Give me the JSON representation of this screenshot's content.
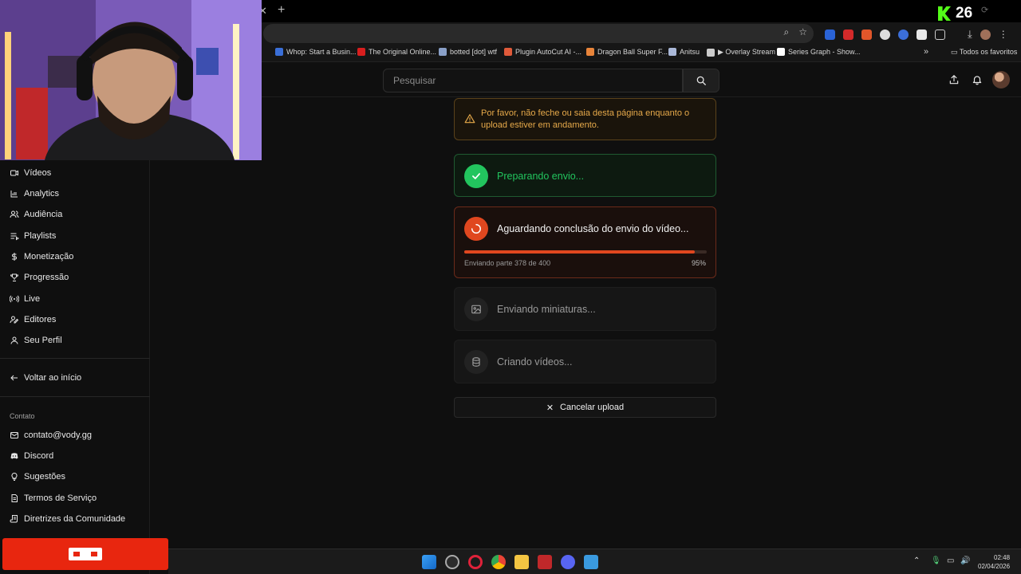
{
  "browser": {
    "kick_viewer_count": "26",
    "bookmarks": [
      {
        "label": "Whop: Start a Busin...",
        "color": "#3a6fd8"
      },
      {
        "label": "The Original Online...",
        "color": "#d81e1e"
      },
      {
        "label": "botted [dot] wtf",
        "color": "#8aa0c8"
      },
      {
        "label": "Plugin AutoCut AI -...",
        "color": "#e05a3a"
      },
      {
        "label": "Dragon Ball Super F...",
        "color": "#e8843a"
      },
      {
        "label": "Anitsu",
        "color": "#aab8d8"
      },
      {
        "label": "▶ Overlay Stream",
        "color": "#cccccc"
      },
      {
        "label": "Series Graph - Show...",
        "color": "#ffffff"
      }
    ],
    "bookmarks_folder": "Todos os favoritos"
  },
  "header": {
    "search_placeholder": "Pesquisar"
  },
  "sidebar": {
    "items": [
      {
        "label": "Vídeos",
        "icon": "video-icon"
      },
      {
        "label": "Analytics",
        "icon": "chart-icon"
      },
      {
        "label": "Audiência",
        "icon": "users-icon"
      },
      {
        "label": "Playlists",
        "icon": "playlist-icon"
      },
      {
        "label": "Monetização",
        "icon": "dollar-icon"
      },
      {
        "label": "Progressão",
        "icon": "trophy-icon"
      },
      {
        "label": "Live",
        "icon": "broadcast-icon"
      },
      {
        "label": "Editores",
        "icon": "user-pen-icon"
      },
      {
        "label": "Seu Perfil",
        "icon": "user-icon"
      }
    ],
    "back_label": "Voltar ao início",
    "contact_title": "Contato",
    "contact_items": [
      {
        "label": "contato@vody.gg",
        "icon": "mail-icon"
      },
      {
        "label": "Discord",
        "icon": "discord-icon"
      },
      {
        "label": "Sugestões",
        "icon": "lightbulb-icon"
      },
      {
        "label": "Termos de Serviço",
        "icon": "document-icon"
      },
      {
        "label": "Diretrizes da Comunidade",
        "icon": "scroll-icon"
      }
    ]
  },
  "upload": {
    "warning": "Por favor, não feche ou saia desta página enquanto o upload estiver em andamento.",
    "steps": {
      "prepare": "Preparando envio...",
      "waiting": "Aguardando conclusão do envio do vídeo...",
      "part_status": "Enviando parte 378 de 400",
      "percent_label": "95%",
      "progress": 0.95,
      "thumbnails": "Enviando miniaturas...",
      "creating": "Criando vídeos..."
    },
    "cancel_label": "Cancelar upload",
    "colors": {
      "success": "#22c55e",
      "active": "#e0471f",
      "warning": "#e6a94a"
    }
  },
  "taskbar": {
    "time": "02:48",
    "date": "02/04/2026"
  }
}
